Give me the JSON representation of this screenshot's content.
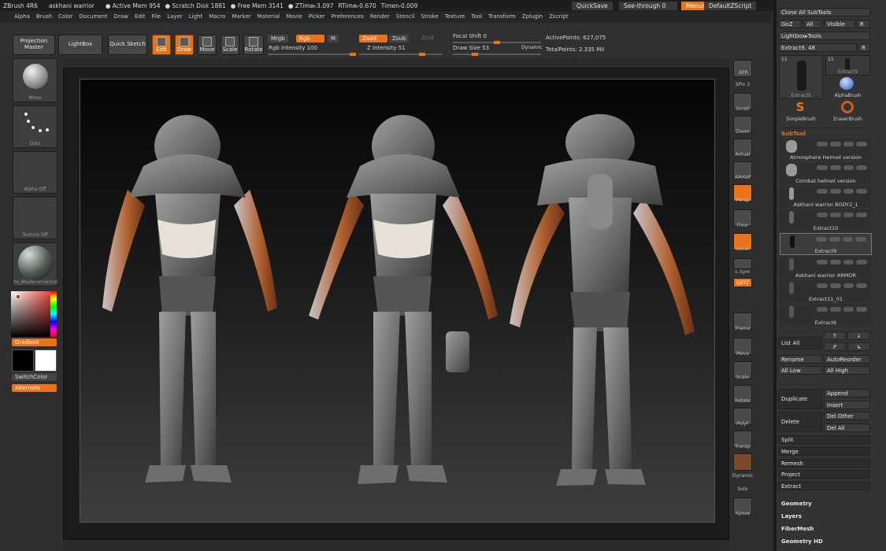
{
  "title_bar": {
    "app": "ZBrush 4R6",
    "doc": "askhani warrior",
    "active_mem": "● Active Mem 954",
    "scratch": "● Scratch Disk 1881",
    "free_mem": "● Free Mem 3141",
    "ztime": "● ZTime▹3.097",
    "rtime": "RTime▹0.670",
    "timer": "Timer▹0.009",
    "quicksave": "QuickSave",
    "see_through": "See-through",
    "see_through_value": "0",
    "menus": "Menus",
    "script": "DefaultZScript"
  },
  "menu": [
    "Alpha",
    "Brush",
    "Color",
    "Document",
    "Draw",
    "Edit",
    "File",
    "Layer",
    "Light",
    "Macro",
    "Marker",
    "Material",
    "Movie",
    "Picker",
    "Preferences",
    "Render",
    "Stencil",
    "Stroke",
    "Texture",
    "Tool",
    "Transform",
    "Zplugin",
    "Zscript"
  ],
  "toolbar": {
    "projection_master": "Projection Master",
    "lightbox": "LightBox",
    "quick_sketch": "Quick Sketch",
    "edit": "Edit",
    "draw": "Draw",
    "move": "Move",
    "scale": "Scale",
    "rotate": "Rotate",
    "mrgb": "Mrgb",
    "rgb": "Rgb",
    "m": "M",
    "rgb_intensity_label": "Rgb Intensity",
    "rgb_intensity": "100",
    "zadd": "Zadd",
    "zsub": "Zsub",
    "zcut": "Zcut",
    "z_intensity_label": "Z Intensity",
    "z_intensity": "51",
    "focal_shift_label": "Focal Shift",
    "focal_shift": "0",
    "draw_size_label": "Draw Size",
    "draw_size": "53",
    "dynamic": "Dynamic",
    "active_points_label": "ActivePoints:",
    "active_points": "627,075",
    "total_points_label": "TotalPoints:",
    "total_points": "2.335 Mil"
  },
  "left_shelf": {
    "brush": "Move",
    "stroke": "Dots",
    "alpha": "Alpha Off",
    "texture": "Texture Off",
    "material": "hs_BladerunnerSol",
    "gradient": "Gradient",
    "switchcolor": "SwitchColor",
    "alternate": "Alternate"
  },
  "right_shelf": {
    "bpr": "BPR",
    "spix_label": "SPix",
    "spix": "3",
    "scroll": "Scroll",
    "zoom": "Zoom",
    "actual": "Actual",
    "aahalf": "AAHalf",
    "persp": "Persp",
    "floor": "Floor",
    "local": "Local",
    "lsym": "L.Sym",
    "xyz": "QXYZ",
    "frame": "Frame",
    "move": "Move",
    "scale": "Scale",
    "rotate": "Rotate",
    "polyf": "PolyF",
    "transp": "Transp",
    "dynamic": "Dynamic",
    "solo": "Solo",
    "xpose": "Xpose"
  },
  "tool_panel": {
    "clone_all": "Clone All SubTools",
    "goz": "GoZ",
    "all": "All",
    "visible": "Visible",
    "r": "R",
    "lightbox_tools": "Lightbox▸Tools",
    "extract_label": "Extract9.",
    "extract_value": "48",
    "thumb1_count": "11",
    "thumb2_count": "11",
    "thumb1": "Extract9",
    "thumb2": "Extract9",
    "alpha_brush": "AlphaBrush",
    "simple_brush": "SimpleBrush",
    "eraser_brush": "EraserBrush"
  },
  "subtool": {
    "header": "SubTool",
    "items": [
      "Atmosphere Helmet version",
      "Combat helmet version",
      "Askhani warrior BODY2_1",
      "Extract10",
      "Extract9",
      "Askhani warrior ARMOR",
      "Extract11_01",
      "Extract6"
    ]
  },
  "subtool_buttons": {
    "list_all": "List All",
    "rename": "Rename",
    "auto_reorder": "AutoReorder",
    "all_low": "All Low",
    "all_high": "All High",
    "duplicate": "Duplicate",
    "append": "Append",
    "insert": "Insert",
    "delete": "Delete",
    "del_other": "Del Other",
    "del_all": "Del All",
    "split": "Split",
    "merge": "Merge",
    "remesh": "Remesh",
    "project": "Project",
    "extract": "Extract"
  },
  "sections": [
    "Geometry",
    "Layers",
    "FiberMesh",
    "Geometry HD"
  ],
  "colors": {
    "accent": "#e8731c",
    "panel": "#333333",
    "viewport_top": "#050505",
    "viewport_bottom": "#3e3e3e"
  }
}
